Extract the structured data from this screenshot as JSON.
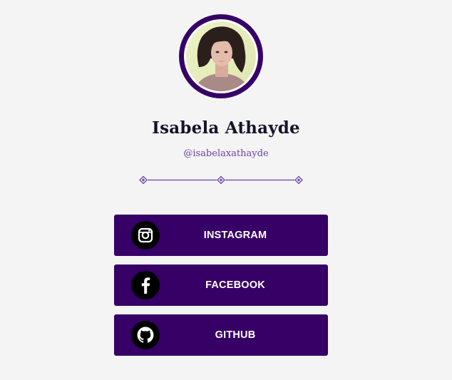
{
  "profile": {
    "name": "Isabela Athayde",
    "handle": "@isabelaxathayde"
  },
  "links": [
    {
      "label": "INSTAGRAM",
      "icon": "instagram-icon"
    },
    {
      "label": "FACEBOOK",
      "icon": "facebook-icon"
    },
    {
      "label": "GITHUB",
      "icon": "github-icon"
    }
  ],
  "theme": {
    "accent": "#360066",
    "background": "#f4f4f5",
    "name_color": "#14142b",
    "handle_color": "#6b3fa3"
  }
}
